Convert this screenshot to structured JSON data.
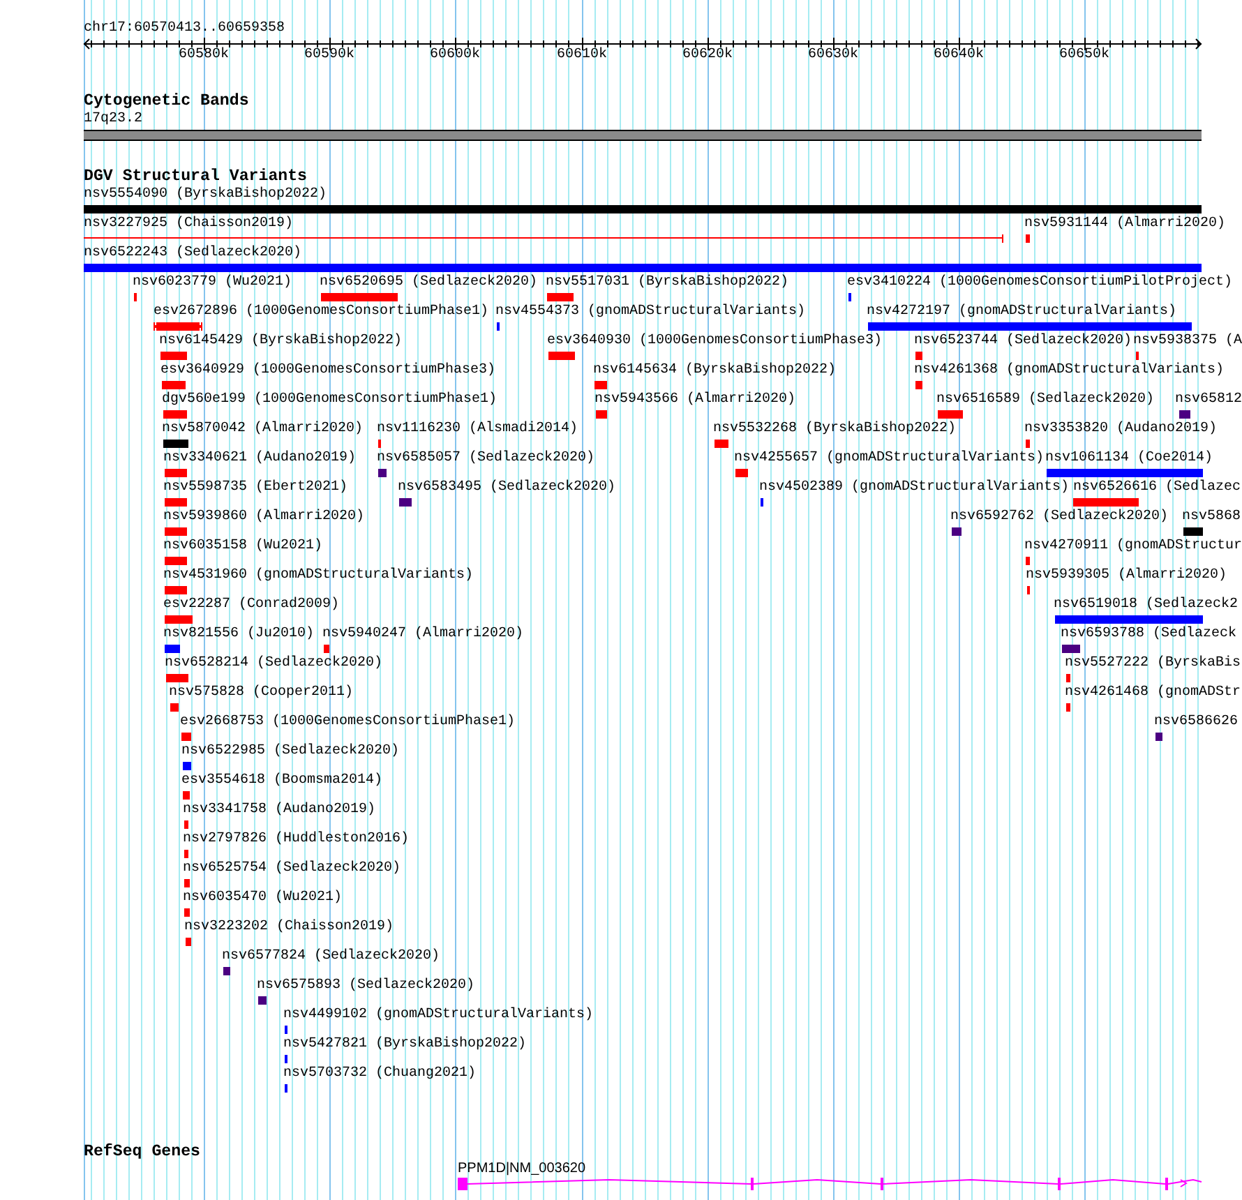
{
  "ruler": {
    "location": "chr17:60570413..60659358",
    "ticks": [
      "60580k",
      "60590k",
      "60600k",
      "60610k",
      "60620k",
      "60630k",
      "60640k",
      "60650k"
    ]
  },
  "cytogenetic_bands": {
    "title": "Cytogenetic Bands",
    "band": "17q23.2"
  },
  "dgv_variants": {
    "title": "DGV Structural Variants",
    "features": [
      {
        "label": "nsv5554090 (ByrskaBishop2022)",
        "color": "#000000",
        "kind": "bar"
      },
      {
        "label": "nsv3227925 (Chaisson2019)",
        "color": "#ff0000",
        "kind": "line"
      },
      {
        "label": "nsv5931144 (Almarri2020)",
        "color": "#ff0000",
        "kind": "bar"
      },
      {
        "label": "nsv6522243 (Sedlazeck2020)",
        "color": "#0000ff",
        "kind": "bar"
      },
      {
        "label": "nsv6023779 (Wu2021)",
        "color": "#ff0000",
        "kind": "bar"
      },
      {
        "label": "nsv6520695 (Sedlazeck2020)",
        "color": "#ff0000",
        "kind": "bar"
      },
      {
        "label": "nsv5517031 (ByrskaBishop2022)",
        "color": "#ff0000",
        "kind": "bar"
      },
      {
        "label": "esv3410224 (1000GenomesConsortiumPilotProject)",
        "color": "#0000ff",
        "kind": "bar"
      },
      {
        "label": "esv2672896 (1000GenomesConsortiumPhase1)",
        "color": "#ff0000",
        "kind": "capped"
      },
      {
        "label": "nsv4554373 (gnomADStructuralVariants)",
        "color": "#0000ff",
        "kind": "bar"
      },
      {
        "label": "nsv4272197 (gnomADStructuralVariants)",
        "color": "#0000ff",
        "kind": "bar"
      },
      {
        "label": "nsv6145429 (ByrskaBishop2022)",
        "color": "#ff0000",
        "kind": "bar"
      },
      {
        "label": "esv3640930 (1000GenomesConsortiumPhase3)",
        "color": "#ff0000",
        "kind": "bar"
      },
      {
        "label": "nsv6523744 (Sedlazeck2020)",
        "color": "#ff0000",
        "kind": "bar"
      },
      {
        "label": "nsv5938375 (A",
        "color": "#ff0000",
        "kind": "bar"
      },
      {
        "label": "esv3640929 (1000GenomesConsortiumPhase3)",
        "color": "#ff0000",
        "kind": "bar"
      },
      {
        "label": "nsv6145634 (ByrskaBishop2022)",
        "color": "#ff0000",
        "kind": "bar"
      },
      {
        "label": "nsv4261368 (gnomADStructuralVariants)",
        "color": "#ff0000",
        "kind": "bar"
      },
      {
        "label": "dgv560e199 (1000GenomesConsortiumPhase1)",
        "color": "#ff0000",
        "kind": "bar"
      },
      {
        "label": "nsv5943566 (Almarri2020)",
        "color": "#ff0000",
        "kind": "bar"
      },
      {
        "label": "nsv6516589 (Sedlazeck2020)",
        "color": "#ff0000",
        "kind": "bar"
      },
      {
        "label": "nsv65812",
        "color": "#4b0082",
        "kind": "bar"
      },
      {
        "label": "nsv5870042 (Almarri2020)",
        "color": "#000000",
        "kind": "bar"
      },
      {
        "label": "nsv1116230 (Alsmadi2014)",
        "color": "#ff0000",
        "kind": "bar"
      },
      {
        "label": "nsv5532268 (ByrskaBishop2022)",
        "color": "#ff0000",
        "kind": "bar"
      },
      {
        "label": "nsv3353820 (Audano2019)",
        "color": "#ff0000",
        "kind": "bar"
      },
      {
        "label": "nsv3340621 (Audano2019)",
        "color": "#ff0000",
        "kind": "bar"
      },
      {
        "label": "nsv6585057 (Sedlazeck2020)",
        "color": "#4b0082",
        "kind": "bar"
      },
      {
        "label": "nsv4255657 (gnomADStructuralVariants)",
        "color": "#ff0000",
        "kind": "bar"
      },
      {
        "label": "nsv1061134 (Coe2014)",
        "color": "#0000ff",
        "kind": "bar"
      },
      {
        "label": "nsv5598735 (Ebert2021)",
        "color": "#ff0000",
        "kind": "bar"
      },
      {
        "label": "nsv6583495 (Sedlazeck2020)",
        "color": "#4b0082",
        "kind": "bar"
      },
      {
        "label": "nsv4502389 (gnomADStructuralVariants)",
        "color": "#0000ff",
        "kind": "bar"
      },
      {
        "label": "nsv6526616 (Sedlazec",
        "color": "#ff0000",
        "kind": "bar"
      },
      {
        "label": "nsv5939860 (Almarri2020)",
        "color": "#ff0000",
        "kind": "bar"
      },
      {
        "label": "nsv6592762 (Sedlazeck2020)",
        "color": "#4b0082",
        "kind": "bar"
      },
      {
        "label": "nsv5868",
        "color": "#000000",
        "kind": "bar"
      },
      {
        "label": "nsv6035158 (Wu2021)",
        "color": "#ff0000",
        "kind": "bar"
      },
      {
        "label": "nsv4270911 (gnomADStructur",
        "color": "#ff0000",
        "kind": "bar"
      },
      {
        "label": "nsv4531960 (gnomADStructuralVariants)",
        "color": "#ff0000",
        "kind": "bar"
      },
      {
        "label": "nsv5939305 (Almarri2020)",
        "color": "#ff0000",
        "kind": "bar"
      },
      {
        "label": "esv22287 (Conrad2009)",
        "color": "#ff0000",
        "kind": "bar"
      },
      {
        "label": "nsv6519018 (Sedlazeck2",
        "color": "#0000ff",
        "kind": "bar"
      },
      {
        "label": "nsv821556 (Ju2010)",
        "color": "#0000ff",
        "kind": "bar"
      },
      {
        "label": "nsv5940247 (Almarri2020)",
        "color": "#ff0000",
        "kind": "bar"
      },
      {
        "label": "nsv6593788 (Sedlazeck",
        "color": "#4b0082",
        "kind": "bar"
      },
      {
        "label": "nsv6528214 (Sedlazeck2020)",
        "color": "#ff0000",
        "kind": "bar"
      },
      {
        "label": "nsv5527222 (ByrskaBis",
        "color": "#ff0000",
        "kind": "bar"
      },
      {
        "label": "nsv575828 (Cooper2011)",
        "color": "#ff0000",
        "kind": "bar"
      },
      {
        "label": "nsv4261468 (gnomADStr",
        "color": "#ff0000",
        "kind": "bar"
      },
      {
        "label": "esv2668753 (1000GenomesConsortiumPhase1)",
        "color": "#ff0000",
        "kind": "bar"
      },
      {
        "label": "nsv6586626",
        "color": "#4b0082",
        "kind": "bar"
      },
      {
        "label": "nsv6522985 (Sedlazeck2020)",
        "color": "#0000ff",
        "kind": "bar"
      },
      {
        "label": "esv3554618 (Boomsma2014)",
        "color": "#ff0000",
        "kind": "bar"
      },
      {
        "label": "nsv3341758 (Audano2019)",
        "color": "#ff0000",
        "kind": "bar"
      },
      {
        "label": "nsv2797826 (Huddleston2016)",
        "color": "#ff0000",
        "kind": "bar"
      },
      {
        "label": "nsv6525754 (Sedlazeck2020)",
        "color": "#ff0000",
        "kind": "bar"
      },
      {
        "label": "nsv6035470 (Wu2021)",
        "color": "#ff0000",
        "kind": "bar"
      },
      {
        "label": "nsv3223202 (Chaisson2019)",
        "color": "#ff0000",
        "kind": "bar"
      },
      {
        "label": "nsv6577824 (Sedlazeck2020)",
        "color": "#4b0082",
        "kind": "bar"
      },
      {
        "label": "nsv6575893 (Sedlazeck2020)",
        "color": "#4b0082",
        "kind": "bar"
      },
      {
        "label": "nsv4499102 (gnomADStructuralVariants)",
        "color": "#0000ff",
        "kind": "bar"
      },
      {
        "label": "nsv5427821 (ByrskaBishop2022)",
        "color": "#0000ff",
        "kind": "bar"
      },
      {
        "label": "nsv5703732 (Chuang2021)",
        "color": "#0000ff",
        "kind": "bar"
      }
    ]
  },
  "refseq_genes": {
    "title": "RefSeq Genes",
    "genes": [
      {
        "label": "PPM1D|NM_003620"
      }
    ]
  }
}
